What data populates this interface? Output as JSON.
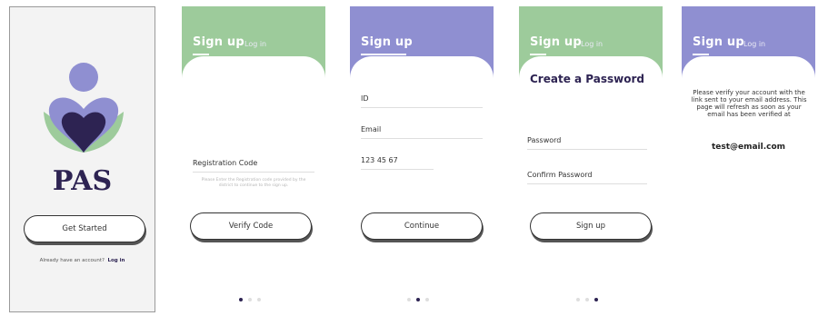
{
  "colors": {
    "green": "#9dcb9b",
    "purple": "#8f8fd1",
    "navy": "#2d2352"
  },
  "welcome": {
    "logo_text": "PAS",
    "get_started_label": "Get Started",
    "already_text": "Already have an account?",
    "login_link": "Log in"
  },
  "registration": {
    "tab_signup": "Sign up",
    "tab_login": "Log in",
    "code_label": "Registration Code",
    "hint": "Please Enter the Registration code provided by the district to continue to the sign up.",
    "verify_button": "Verify Code"
  },
  "details": {
    "tab_signup": "Sign up",
    "id_label": "ID",
    "email_label": "Email",
    "phone_value": "123 45 67",
    "continue_button": "Continue"
  },
  "password": {
    "tab_signup": "Sign up",
    "tab_login": "Log in",
    "title": "Create a Password",
    "password_label": "Password",
    "confirm_label": "Confirm Password",
    "signup_button": "Sign up"
  },
  "verify": {
    "tab_signup": "Sign up",
    "tab_login": "Log in",
    "message": "Please verify your account with the link sent to your email address. This page will refresh as soon as your email has been verified at",
    "email": "test@email.com"
  }
}
